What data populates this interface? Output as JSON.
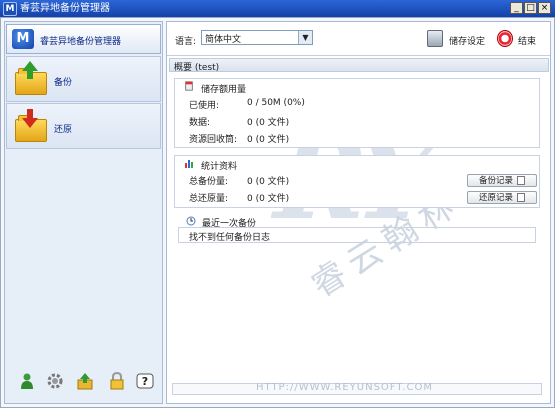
{
  "window": {
    "title": "睿芸异地备份管理器",
    "icon_letter": "M",
    "buttons": [
      "_",
      "□",
      "×"
    ]
  },
  "sidebar": {
    "header_label": "睿芸异地备份管理器",
    "header_icon_letter": "M",
    "items": [
      {
        "label": "备份"
      },
      {
        "label": "还原"
      }
    ],
    "bottom_icons": [
      "user-icon",
      "gear-icon",
      "update-icon",
      "lock-icon",
      "help-icon"
    ],
    "help_glyph": "?"
  },
  "toolbar": {
    "language_label": "语言:",
    "language_value": "简体中文",
    "dropdown_glyph": "▼",
    "settings_label": "储存设定",
    "exit_label": "结束"
  },
  "summary": {
    "title": "概要 (test)",
    "storage": {
      "title": "储存额用量",
      "rows": [
        {
          "label": "已使用:",
          "value": "0 / 50M (0%)"
        },
        {
          "label": "数据:",
          "value": "0  (0 文件)"
        },
        {
          "label": "资源回收筒:",
          "value": "0  (0 文件)"
        }
      ]
    },
    "stats": {
      "title": "统计资料",
      "rows": [
        {
          "label": "总备份量:",
          "value": "0  (0 文件)",
          "button": "备份记录"
        },
        {
          "label": "总还原量:",
          "value": "0  (0 文件)",
          "button": "还原记录"
        }
      ]
    },
    "last_backup": {
      "title": "最近一次备份",
      "message": "找不到任何备份日志"
    }
  },
  "watermark": {
    "letters": "RY",
    "chinese": "睿云翰林",
    "url": "HTTP://WWW.REYUNSOFT.COM"
  },
  "colors": {
    "titlebar": "#1f52c0",
    "nav_text": "#0b2a86",
    "panel_bg": "#e6eef8"
  }
}
